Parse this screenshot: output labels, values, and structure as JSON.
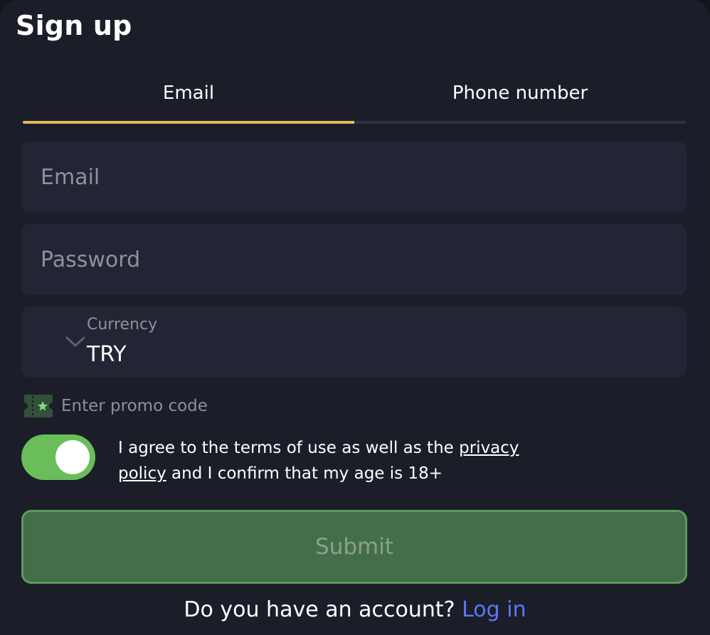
{
  "form": {
    "title": "Sign up"
  },
  "tabs": {
    "email": "Email",
    "phone": "Phone number",
    "active": "email"
  },
  "fields": {
    "email_placeholder": "Email",
    "email_value": "",
    "password_placeholder": "Password",
    "password_value": "",
    "currency_label": "Currency",
    "currency_value": "TRY"
  },
  "promo": {
    "label": "Enter promo code",
    "icon": "promo-ticket-icon"
  },
  "agreement": {
    "toggle_on": true,
    "text_before": "I agree to the terms of use as well as the ",
    "link_text": "privacy policy",
    "text_after": " and I confirm that my age is 18+"
  },
  "actions": {
    "submit_label": "Submit",
    "account_question": "Do you have an account?",
    "login_link": "Log in"
  },
  "colors": {
    "background": "#1b1e29",
    "field": "#222534",
    "accent_tab": "#e4b95b",
    "toggle_on": "#6bbd5c",
    "submit_bg": "#436e49",
    "link": "#5a79f0"
  }
}
